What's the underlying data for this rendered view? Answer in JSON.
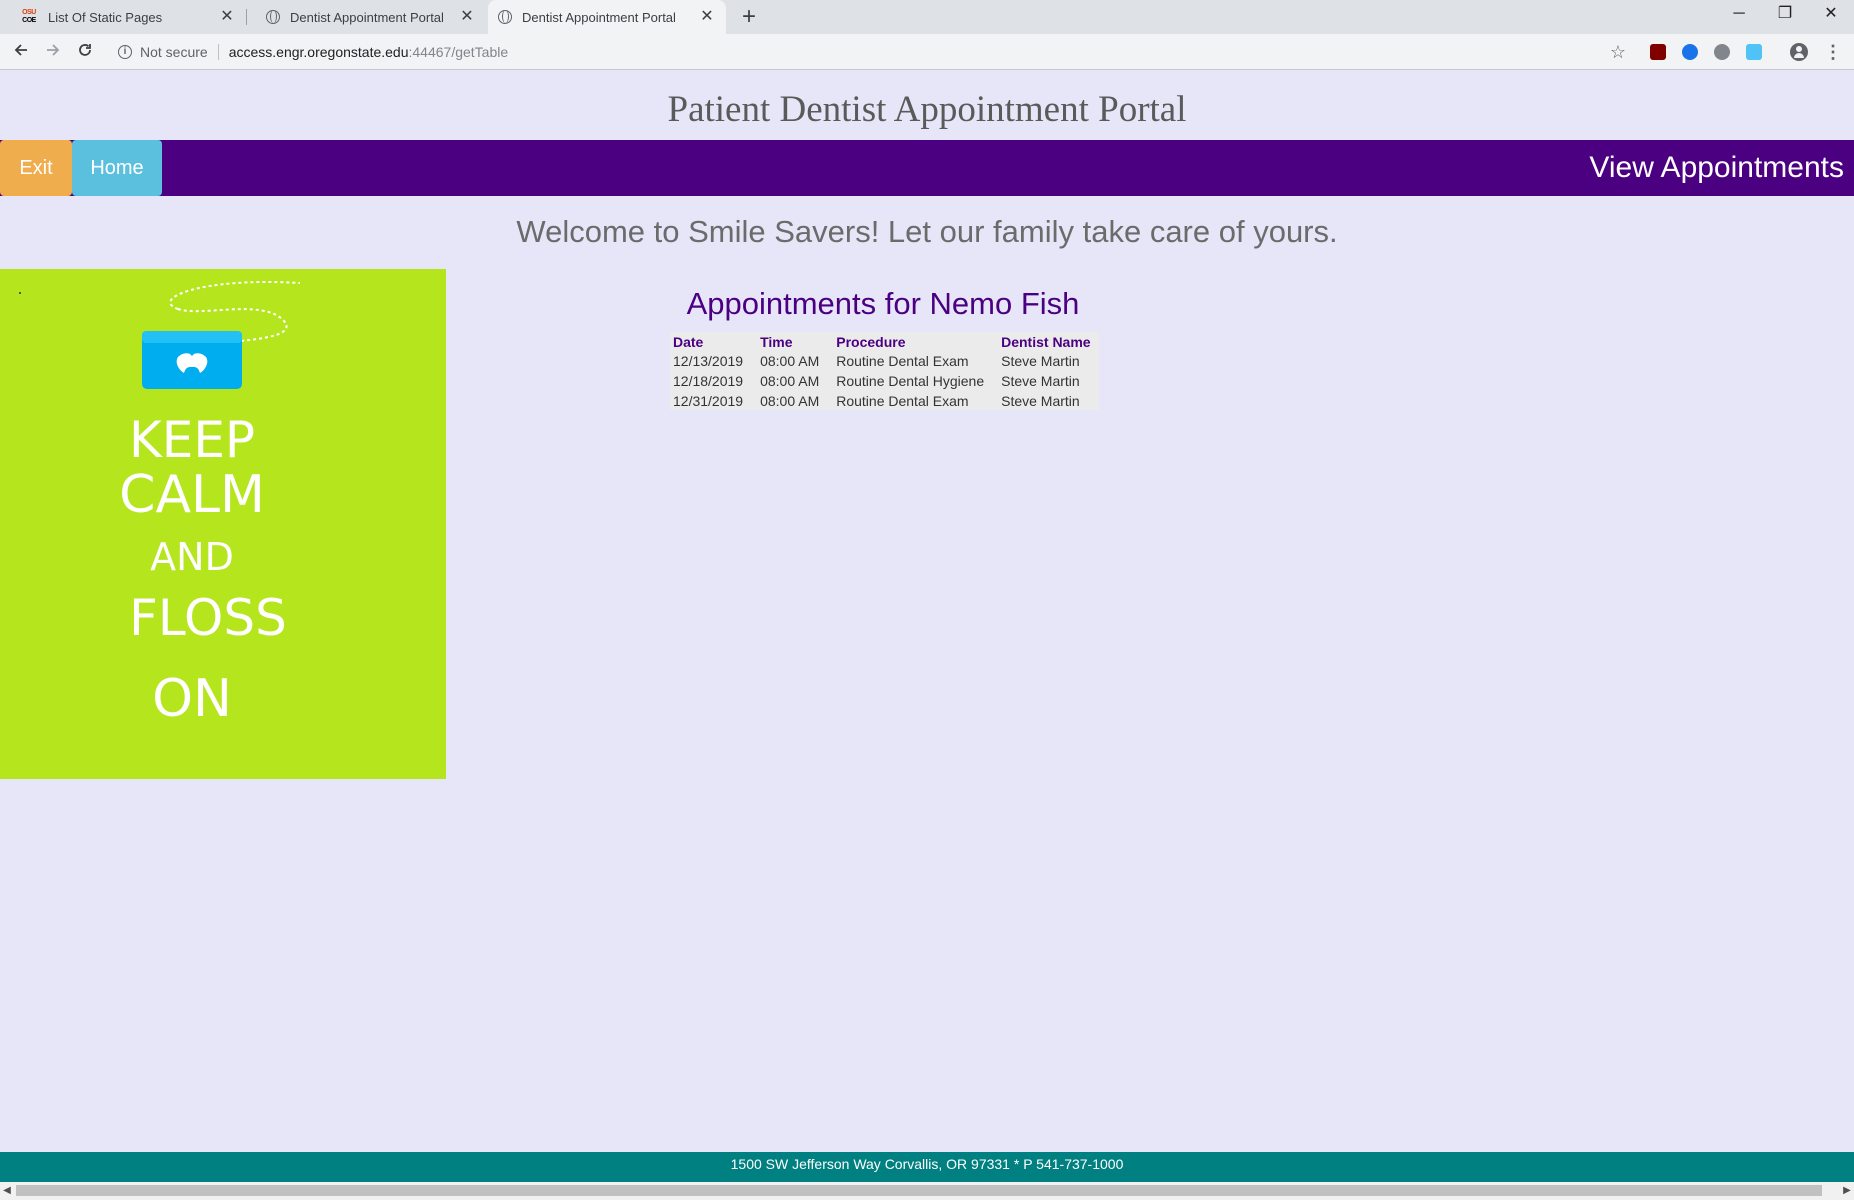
{
  "browser": {
    "tabs": [
      {
        "title": "List Of Static Pages",
        "icon": "osu-favicon",
        "active": false
      },
      {
        "title": "Dentist Appointment Portal",
        "icon": "globe-icon",
        "active": false
      },
      {
        "title": "Dentist Appointment Portal",
        "icon": "globe-icon",
        "active": true
      }
    ],
    "tab_close": "✕",
    "new_tab": "+",
    "window_controls": {
      "minimize": "─",
      "restore": "❐",
      "close": "✕"
    },
    "security_label": "Not secure",
    "url_host": "access.engr.oregonstate.edu",
    "url_rest": ":44467/getTable",
    "osu_icon_top": "OSU",
    "osu_icon_bottom": "COE"
  },
  "header": {
    "title": "Patient Dentist Appointment Portal"
  },
  "navbar": {
    "exit_label": "Exit",
    "home_label": "Home",
    "heading": "View Appointments",
    "colors": {
      "bar": "#4b0082",
      "exit": "#f0ad4e",
      "home": "#5bc0de"
    }
  },
  "welcome": "Welcome to Smile Savers! Let our family take care of yours.",
  "poster": {
    "lines": [
      "KEEP",
      "CALM",
      "AND",
      "FLOSS",
      "ON"
    ],
    "background": "#b5e51d"
  },
  "appointments": {
    "heading": "Appointments for Nemo Fish",
    "columns": [
      "Date",
      "Time",
      "Procedure",
      "Dentist Name"
    ],
    "rows": [
      [
        "12/13/2019",
        "08:00 AM",
        "Routine Dental Exam",
        "Steve Martin"
      ],
      [
        "12/18/2019",
        "08:00 AM",
        "Routine Dental Hygiene",
        "Steve Martin"
      ],
      [
        "12/31/2019",
        "08:00 AM",
        "Routine Dental Exam",
        "Steve Martin"
      ]
    ]
  },
  "footer": {
    "text": "1500 SW Jefferson Way Corvallis, OR 97331 * P 541-737-1000",
    "color": "#008080"
  }
}
